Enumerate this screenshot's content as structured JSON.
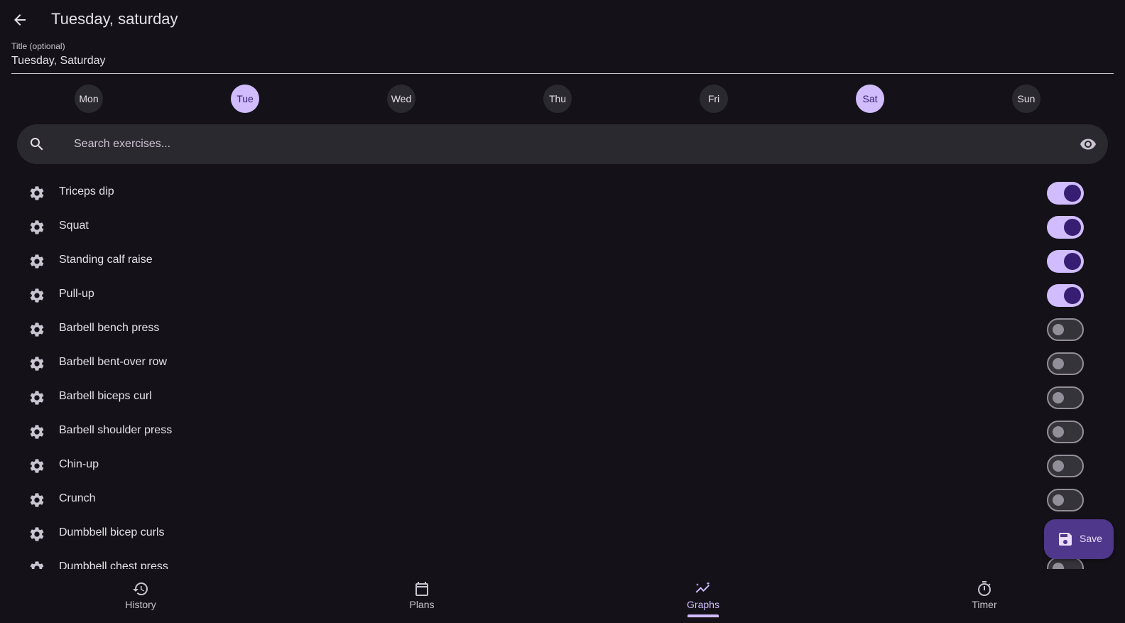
{
  "app_bar": {
    "title": "Tuesday, saturday"
  },
  "title_field": {
    "label": "Title (optional)",
    "value": "Tuesday, Saturday"
  },
  "days": [
    {
      "label": "Mon",
      "selected": false
    },
    {
      "label": "Tue",
      "selected": true
    },
    {
      "label": "Wed",
      "selected": false
    },
    {
      "label": "Thu",
      "selected": false
    },
    {
      "label": "Fri",
      "selected": false
    },
    {
      "label": "Sat",
      "selected": true
    },
    {
      "label": "Sun",
      "selected": false
    }
  ],
  "search": {
    "placeholder": "Search exercises...",
    "icon": "search-icon",
    "toggle_icon": "eye-icon"
  },
  "exercises": [
    {
      "name": "Triceps dip",
      "enabled": true
    },
    {
      "name": "Squat",
      "enabled": true
    },
    {
      "name": "Standing calf raise",
      "enabled": true
    },
    {
      "name": "Pull-up",
      "enabled": true
    },
    {
      "name": "Barbell bench press",
      "enabled": false
    },
    {
      "name": "Barbell bent-over row",
      "enabled": false
    },
    {
      "name": "Barbell biceps curl",
      "enabled": false
    },
    {
      "name": "Barbell shoulder press",
      "enabled": false
    },
    {
      "name": "Chin-up",
      "enabled": false
    },
    {
      "name": "Crunch",
      "enabled": false
    },
    {
      "name": "Dumbbell bicep curls",
      "enabled": false
    },
    {
      "name": "Dumbbell chest press",
      "enabled": false
    }
  ],
  "fab": {
    "label": "Save",
    "icon": "save-icon"
  },
  "bottom_nav": {
    "items": [
      {
        "label": "History",
        "icon": "history-icon",
        "active": false
      },
      {
        "label": "Plans",
        "icon": "calendar-icon",
        "active": false
      },
      {
        "label": "Graphs",
        "icon": "graph-icon",
        "active": true
      },
      {
        "label": "Timer",
        "icon": "timer-icon",
        "active": false
      }
    ]
  },
  "colors": {
    "background": "#141218",
    "accent": "#d0bcff",
    "on_accent": "#381e72",
    "surface": "#2b2930",
    "fab": "#4f378b"
  }
}
